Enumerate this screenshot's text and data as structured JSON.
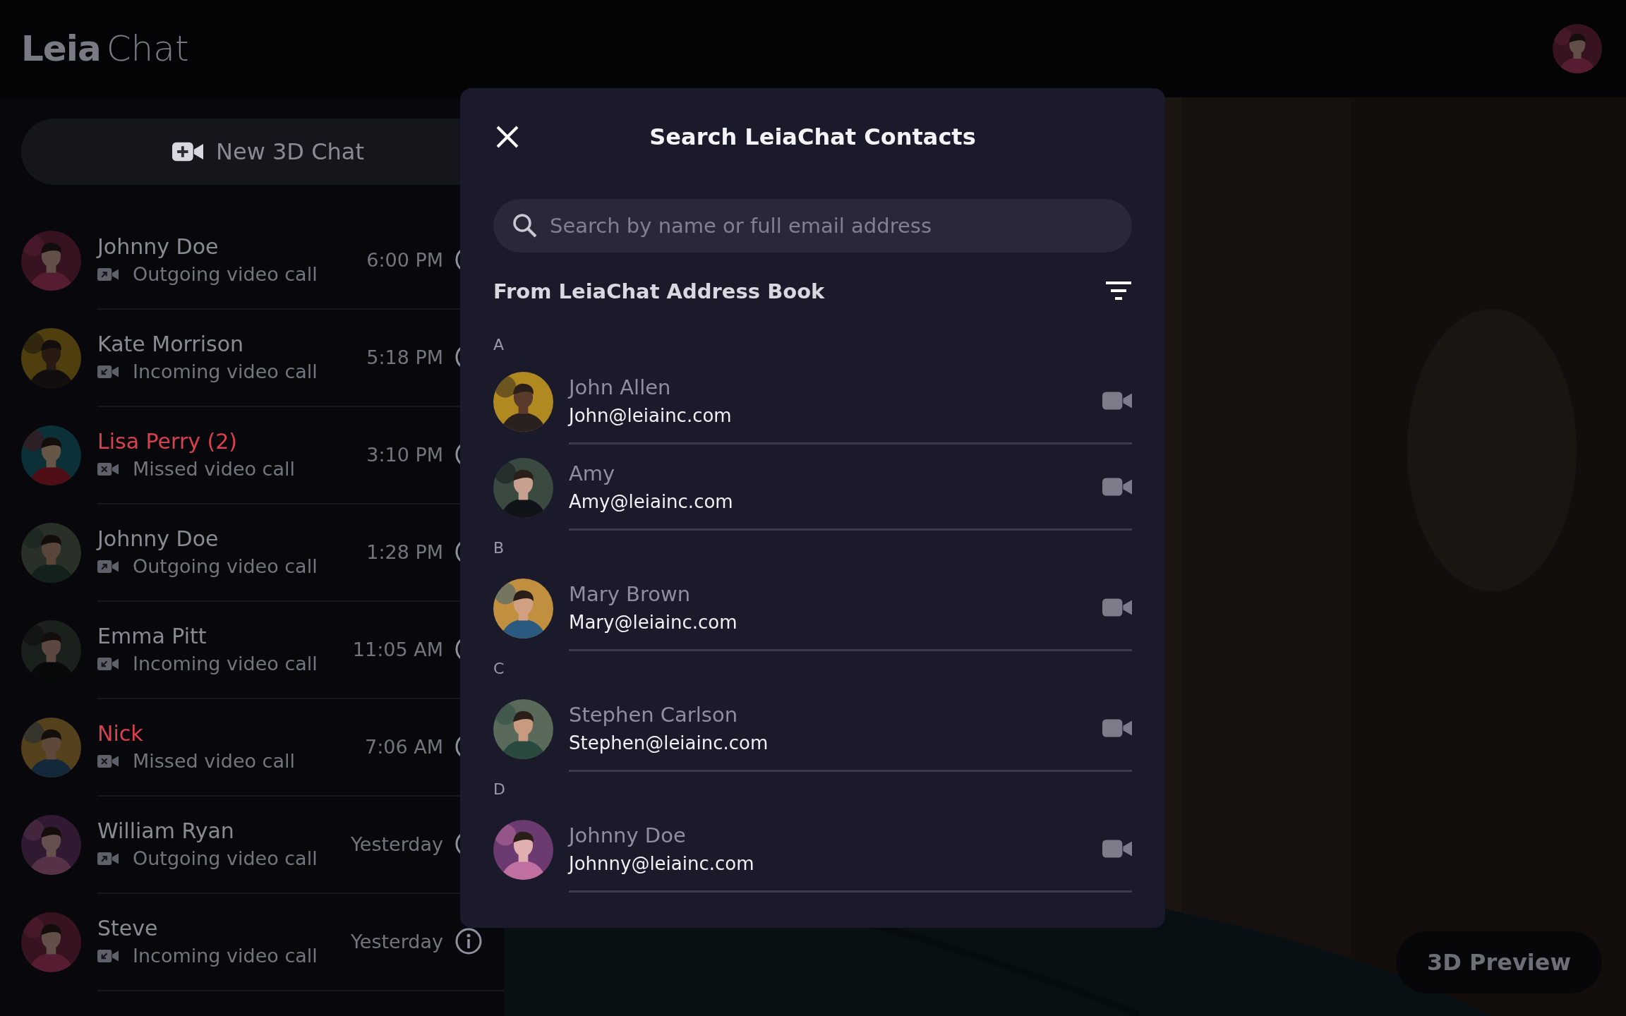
{
  "app": {
    "logo_bold": "Leia",
    "logo_light": "Chat"
  },
  "new_chat_button": "New 3D Chat",
  "conversations": [
    {
      "name": "Johnny Doe",
      "kind": "outgoing",
      "status": "Outgoing video call",
      "time": "6:00 PM"
    },
    {
      "name": "Kate Morrison",
      "kind": "incoming",
      "status": "Incoming video call",
      "time": "5:18 PM"
    },
    {
      "name": "Lisa Perry (2)",
      "kind": "missed",
      "status": "Missed video call",
      "time": "3:10 PM"
    },
    {
      "name": "Johnny Doe",
      "kind": "outgoing",
      "status": "Outgoing video call",
      "time": "1:28 PM"
    },
    {
      "name": "Emma Pitt",
      "kind": "incoming",
      "status": "Incoming video call",
      "time": "11:05 AM"
    },
    {
      "name": "Nick",
      "kind": "missed",
      "status": "Missed video call",
      "time": "7:06 AM"
    },
    {
      "name": "William Ryan",
      "kind": "outgoing",
      "status": "Outgoing video call",
      "time": "Yesterday"
    },
    {
      "name": "Steve",
      "kind": "incoming",
      "status": "Incoming video call",
      "time": "Yesterday"
    }
  ],
  "preview_button": "3D Preview",
  "modal": {
    "title": "Search LeiaChat Contacts",
    "search": {
      "placeholder": "Search by name or full email address"
    },
    "section_title": "From LeiaChat Address Book",
    "groups": [
      {
        "letter": "A",
        "contacts": [
          {
            "name": "John Allen",
            "email": "John@leiainc.com"
          },
          {
            "name": "Amy",
            "email": "Amy@leiainc.com"
          }
        ]
      },
      {
        "letter": "B",
        "contacts": [
          {
            "name": "Mary Brown",
            "email": "Mary@leiainc.com"
          }
        ]
      },
      {
        "letter": "C",
        "contacts": [
          {
            "name": "Stephen Carlson",
            "email": "Stephen@leiainc.com"
          }
        ]
      },
      {
        "letter": "D",
        "contacts": [
          {
            "name": "Johnny Doe",
            "email": "Johnny@leiainc.com"
          }
        ]
      }
    ]
  }
}
